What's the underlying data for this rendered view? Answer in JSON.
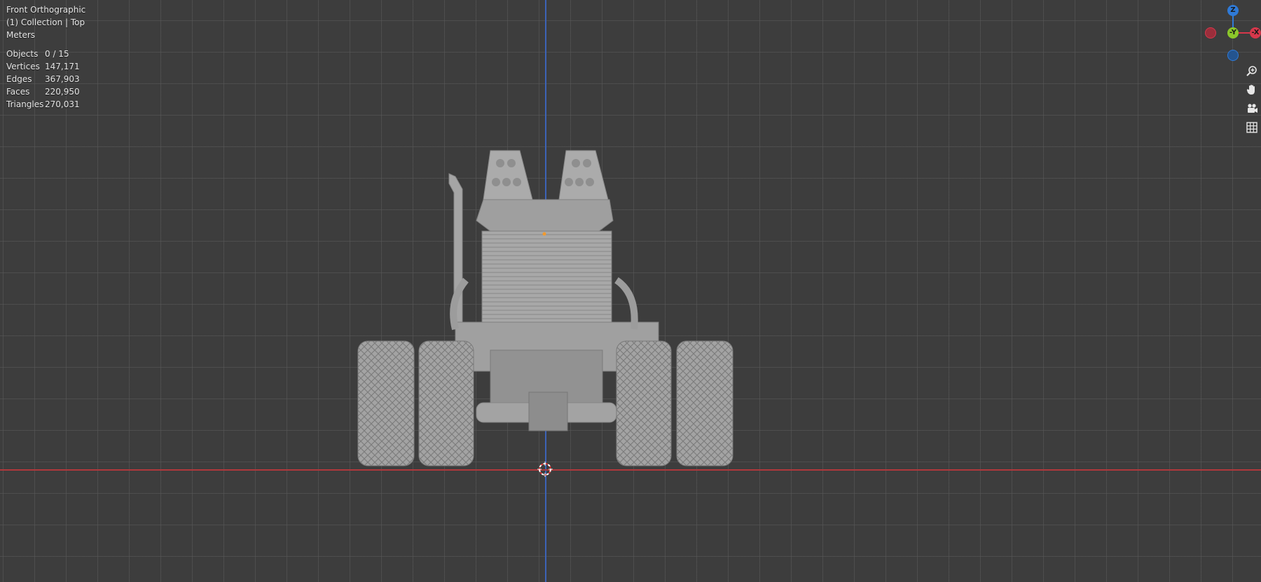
{
  "viewport": {
    "view_name": "Front Orthographic",
    "collection": "(1) Collection | Top",
    "units": "Meters"
  },
  "stats": [
    {
      "label": "Objects",
      "value": "0 / 15"
    },
    {
      "label": "Vertices",
      "value": "147,171"
    },
    {
      "label": "Edges",
      "value": "367,903"
    },
    {
      "label": "Faces",
      "value": "220,950"
    },
    {
      "label": "Triangles",
      "value": "270,031"
    }
  ],
  "gizmo": {
    "z_label": "Z",
    "y_label": "-Y",
    "x_label": "-X",
    "colors": {
      "x": "#d7374b",
      "y": "#8bc72a",
      "z": "#2f7ad7"
    }
  },
  "nav_tools": [
    {
      "name": "zoom-icon"
    },
    {
      "name": "pan-hand-icon"
    },
    {
      "name": "camera-icon"
    },
    {
      "name": "grid-icon"
    }
  ],
  "colors": {
    "background": "#3d3d3d",
    "x_axis_line": "#b0383c",
    "y_axis_line": "#3c63b7",
    "model": "#9a9a9a"
  }
}
